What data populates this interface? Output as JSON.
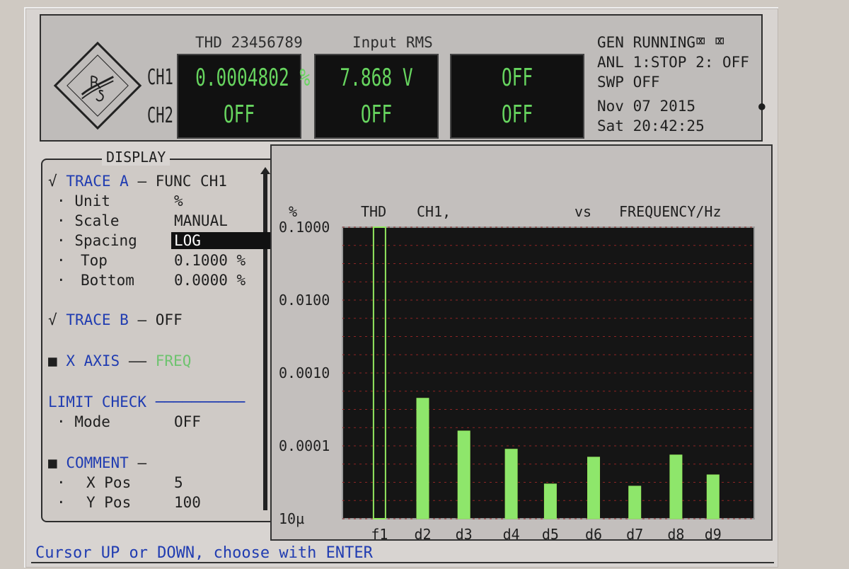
{
  "header": {
    "label_thd": "THD 23456789",
    "label_input": "Input RMS",
    "ch1_label": "CH1",
    "ch2_label": "CH2",
    "ch1_thd": "0.0004802 %",
    "ch1_input": "7.868 V",
    "ch1_third": "OFF",
    "ch2_thd": "OFF",
    "ch2_input": "OFF",
    "ch2_third": "OFF",
    "status1": "GEN RUNNING",
    "status2": "ANL 1:STOP 2: OFF",
    "status3": "SWP OFF",
    "date": "Nov 07 2015",
    "time": "Sat 20:42:25"
  },
  "display": {
    "title": "DISPLAY",
    "trace_a": "TRACE A",
    "trace_a_value": "FUNC CH1",
    "unit_label": "Unit",
    "unit_value": "%",
    "scale_label": "Scale",
    "scale_value": "MANUAL",
    "spacing_label": "Spacing",
    "spacing_value": "LOG",
    "top_label": "Top",
    "top_value": "0.1000 %",
    "bottom_label": "Bottom",
    "bottom_value": "0.0000 %",
    "trace_b": "TRACE B",
    "trace_b_value": "OFF",
    "x_axis": "X AXIS",
    "x_axis_value": "FREQ",
    "limit_check": "LIMIT CHECK",
    "mode_label": "Mode",
    "mode_value": "OFF",
    "comment": "COMMENT",
    "xpos_label": "X Pos",
    "xpos_value": "5",
    "ypos_label": "Y Pos",
    "ypos_value": "100"
  },
  "footer": {
    "hint": "Cursor UP or DOWN, choose with ENTER"
  },
  "colors": {
    "bar_fill": "#8ee66b",
    "bar_outline": "#93e85f",
    "grid": "#8f2525",
    "plot_bg": "#151515"
  },
  "chart_data": {
    "type": "bar",
    "ylabel": "%",
    "labels": {
      "left": "THD",
      "middle": "CH1,",
      "vs": "vs",
      "right": "FREQUENCY/Hz"
    },
    "categories": [
      "f1",
      "d2",
      "d3",
      "d4",
      "d5",
      "d6",
      "d7",
      "d8",
      "d9"
    ],
    "values": [
      0.1,
      0.00045,
      0.00016,
      9e-05,
      3e-05,
      7e-05,
      2.8e-05,
      7.5e-05,
      4e-05
    ],
    "yticks": [
      "0.1000",
      "0.0100",
      "0.0010",
      "0.0001",
      "10µ"
    ],
    "ylim": [
      1e-05,
      0.1
    ],
    "log_scale": true,
    "grid": true
  }
}
